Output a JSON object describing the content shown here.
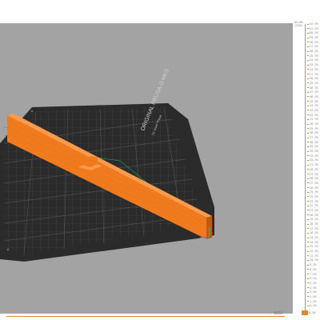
{
  "viewport": {
    "bed_brand": "ORIGINAL PRUSA i3 MK3",
    "bed_subtitle": "by Josef Prusa"
  },
  "horizontal_slider": {
    "value": "10157"
  },
  "vertical_slider": {
    "top_values": [
      "63.05",
      "(315)"
    ],
    "bottom_value": "0.20",
    "ticks": [
      "62.95",
      "61.95",
      "60.95",
      "59.95",
      "58.95",
      "57.95",
      "56.95",
      "55.95",
      "54.95",
      "53.95",
      "52.95",
      "51.95",
      "50.95",
      "49.95",
      "48.95",
      "47.95",
      "46.95",
      "45.95",
      "44.95",
      "43.95",
      "42.95",
      "41.95",
      "40.95",
      "39.95",
      "38.95",
      "37.95",
      "36.95",
      "35.95",
      "34.95",
      "33.95",
      "32.95",
      "31.95",
      "30.95",
      "29.95",
      "28.95",
      "27.95",
      "26.95",
      "25.95",
      "24.95",
      "23.95",
      "22.95",
      "21.95",
      "20.95",
      "19.95",
      "18.95",
      "17.95",
      "16.95",
      "15.95",
      "14.95",
      "13.95",
      "12.95",
      "11.95",
      "10.95",
      "9.95",
      "8.95",
      "7.95",
      "6.95",
      "5.95",
      "4.95",
      "3.95",
      "2.95",
      "1.95",
      "0.95"
    ]
  },
  "colors": {
    "model": "#f07a1e",
    "bed": "#2b2b2b",
    "accent": "#e08a2a",
    "background": "#a3a3a3"
  }
}
